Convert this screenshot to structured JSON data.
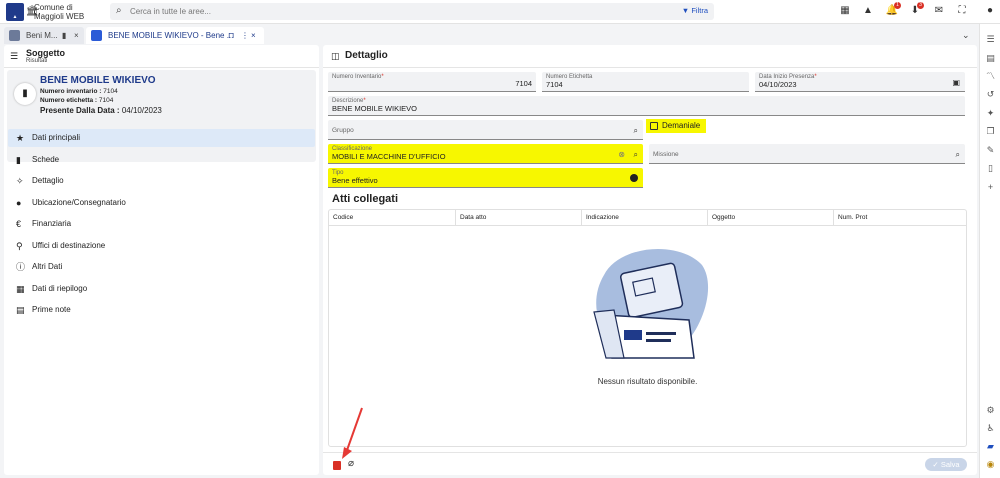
{
  "topbar": {
    "app_name_line1": "Comune di",
    "app_name_line2": "Maggioli WEB",
    "search_placeholder": "Cerca in tutte le aree...",
    "filter_label": "Filtra",
    "notif_badge": "1",
    "download_badge": "3"
  },
  "tabs": [
    {
      "label": "Beni M..."
    },
    {
      "label": "BENE MOBILE WIKIEVO - Bene ..."
    }
  ],
  "left": {
    "title": "Soggetto",
    "subtitle": "Risultati",
    "card": {
      "title": "BENE MOBILE WIKIEVO",
      "inv_label": "Numero inventario :",
      "inv_value": "7104",
      "etic_label": "Numero etichetta :",
      "etic_value": "7104",
      "presente_label": "Presente Dalla Data :",
      "presente_value": "04/10/2023"
    },
    "menu": [
      {
        "label": "Dati principali",
        "icon": "star-icon"
      },
      {
        "label": "Schede",
        "icon": "document-icon"
      },
      {
        "label": "Dettaglio",
        "icon": "magic-wand-icon"
      },
      {
        "label": "Ubicazione/Consegnatario",
        "icon": "person-icon"
      },
      {
        "label": "Finanziaria",
        "icon": "euro-icon"
      },
      {
        "label": "Uffici di destinazione",
        "icon": "location-pin-icon"
      },
      {
        "label": "Altri Dati",
        "icon": "info-icon"
      },
      {
        "label": "Dati di riepilogo",
        "icon": "calculator-icon"
      },
      {
        "label": "Prime note",
        "icon": "note-icon"
      }
    ]
  },
  "right": {
    "title": "Dettaglio",
    "fields": {
      "num_inv": {
        "label": "Numero Inventario",
        "value": "7104"
      },
      "num_etic": {
        "label": "Numero Etichetta",
        "value": "7104"
      },
      "data_inizio": {
        "label": "Data Inizio Presenza",
        "value": "04/10/2023"
      },
      "descrizione": {
        "label": "Descrizione",
        "value": "BENE MOBILE WIKIEVO"
      },
      "gruppo": {
        "label": "Gruppo",
        "value": ""
      },
      "demaniale": {
        "label": "Demaniale"
      },
      "classificazione": {
        "label": "Classificazione",
        "value": "MOBILI E MACCHINE D'UFFICIO"
      },
      "missione": {
        "label": "Missione",
        "value": ""
      },
      "tipo": {
        "label": "Tipo",
        "value": "Bene effettivo"
      }
    },
    "atti_title": "Atti collegati",
    "table_headers": [
      "Codice",
      "Data atto",
      "Indicazione",
      "Oggetto",
      "Num. Prot"
    ],
    "empty_text": "Nessun risultato disponibile.",
    "save_label": "Salva"
  },
  "colors": {
    "highlight": "#f7f700",
    "brand": "#1f3a8a",
    "active_menu": "#dde9f8",
    "danger": "#d93025"
  }
}
